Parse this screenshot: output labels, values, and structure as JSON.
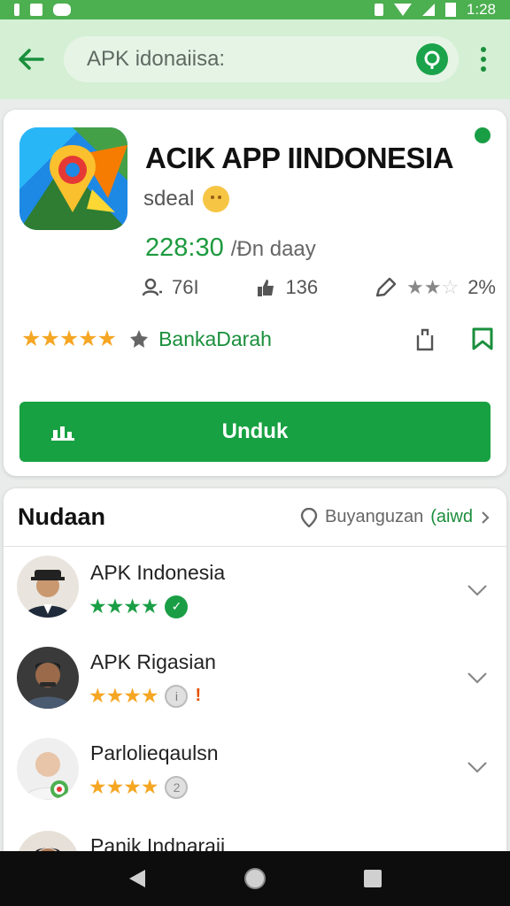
{
  "status_bar": {
    "time": "1:28"
  },
  "search": {
    "placeholder": "APK idonaiisa:"
  },
  "app": {
    "title": "ACIK APP IINDONESIA",
    "developer": "sdeal",
    "price": "228:30",
    "price_suffix": "/Ðn daay",
    "stat_downloads": "76I",
    "stat_likes": "136",
    "stat_rating_pct": "2%",
    "rating_value": 4.5,
    "category": "BankaDarah",
    "install_label": "Unduk",
    "colors": {
      "accent": "#18a142",
      "star": "#f5a623",
      "header_bg": "#d4efd4"
    }
  },
  "reviews": {
    "title": "Nudaan",
    "link_text": "Buyanguzan",
    "link_extra": "(aiwd",
    "items": [
      {
        "name": "APK Indonesia",
        "stars": 4,
        "star_color": "green",
        "badge": "green-check"
      },
      {
        "name": "APK Rigasian",
        "stars": 4,
        "star_color": "orange",
        "badge": "info-grey"
      },
      {
        "name": "Parlolieqaulsn",
        "stars": 4,
        "star_color": "orange",
        "badge": "grey-2"
      },
      {
        "name": "Panik Indnaraii",
        "stars": 0,
        "star_color": "orange",
        "badge": ""
      }
    ]
  },
  "icons": {
    "back": "arrow-left-icon",
    "search": "search-icon",
    "menu": "more-vert-icon",
    "share": "share-icon",
    "bookmark": "bookmark-icon",
    "nav_back": "nav-back-icon",
    "nav_home": "nav-home-icon",
    "nav_recents": "nav-recents-icon"
  }
}
